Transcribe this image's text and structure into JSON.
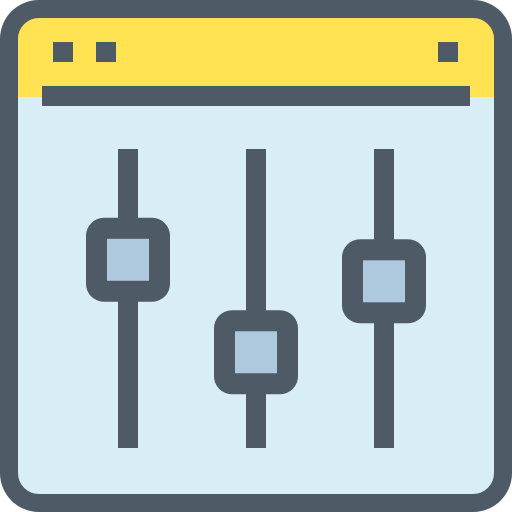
{
  "icon": {
    "name": "settings-sliders-window-icon",
    "colors": {
      "outline": "#4e5b66",
      "titlebar": "#ffe353",
      "window_body": "#d9edf6",
      "knob_fill": "#aec8dd"
    },
    "titlebar_dots": {
      "left_count": 2,
      "right_count": 1
    },
    "sliders": [
      {
        "name": "slider-1",
        "level": 0.68
      },
      {
        "name": "slider-2",
        "level": 0.25
      },
      {
        "name": "slider-3",
        "level": 0.58
      }
    ]
  }
}
